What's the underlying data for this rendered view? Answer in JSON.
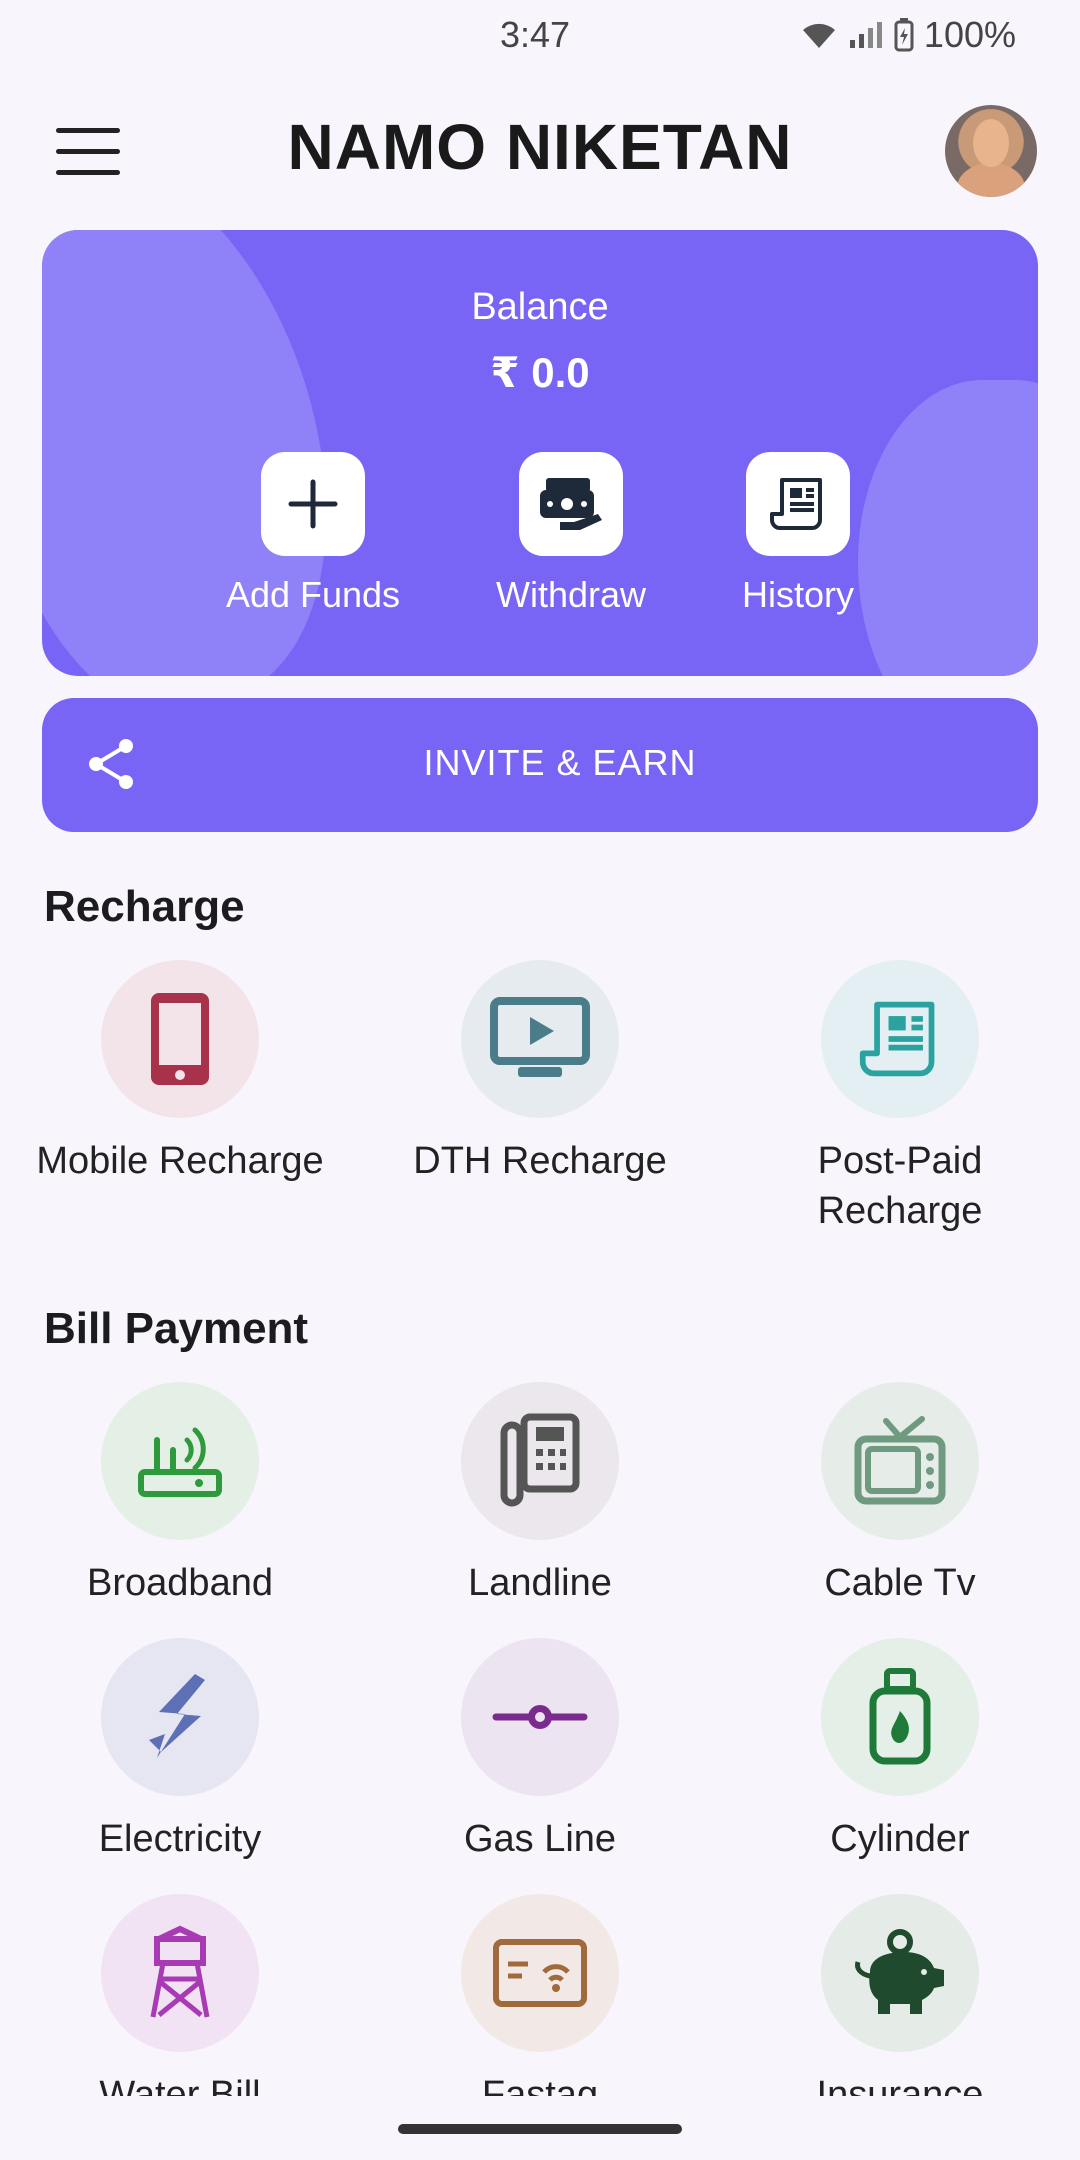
{
  "status": {
    "time": "3:47",
    "battery": "100%"
  },
  "app": {
    "title": "NAMO NIKETAN"
  },
  "balance": {
    "label": "Balance",
    "value": "₹ 0.0",
    "actions": [
      {
        "label": "Add Funds",
        "icon": "plus-icon"
      },
      {
        "label": "Withdraw",
        "icon": "cash-hand-icon"
      },
      {
        "label": "History",
        "icon": "receipt-icon"
      }
    ]
  },
  "invite": {
    "label": "INVITE & EARN",
    "icon": "share-icon"
  },
  "recharge": {
    "title": "Recharge",
    "items": [
      {
        "label": "Mobile Recharge",
        "icon": "mobile-phone-icon",
        "color": "#a8324a",
        "bg": "#f3e4ea"
      },
      {
        "label": "DTH Recharge",
        "icon": "tv-play-icon",
        "color": "#4a7c8a",
        "bg": "#e6ebf0"
      },
      {
        "label": "Post-Paid Recharge",
        "icon": "receipt-icon",
        "color": "#2aa3a0",
        "bg": "#e3eff2"
      }
    ]
  },
  "bills": {
    "title": "Bill Payment",
    "items": [
      {
        "label": "Broadband",
        "icon": "router-icon",
        "color": "#2f9a3c",
        "bg": "#e4efe6"
      },
      {
        "label": "Landline",
        "icon": "landline-phone-icon",
        "color": "#555",
        "bg": "#ebe7ec"
      },
      {
        "label": "Cable Tv",
        "icon": "tv-icon",
        "color": "#6f9a80",
        "bg": "#e6ede9"
      },
      {
        "label": "Electricity",
        "icon": "lightning-icon",
        "color": "#5d6fb5",
        "bg": "#e5e6f2"
      },
      {
        "label": "Gas Line",
        "icon": "gas-pipe-icon",
        "color": "#7b2a8e",
        "bg": "#ece4f0"
      },
      {
        "label": "Cylinder",
        "icon": "gas-cylinder-icon",
        "color": "#1f7a3a",
        "bg": "#e3efe7"
      },
      {
        "label": "Water Bill",
        "icon": "water-tower-icon",
        "color": "#a83bb4",
        "bg": "#f1e3f4"
      },
      {
        "label": "Fastag",
        "icon": "fastag-card-icon",
        "color": "#a06a3c",
        "bg": "#f2e9e6"
      },
      {
        "label": "Insurance",
        "icon": "piggy-bank-icon",
        "color": "#1f4a2e",
        "bg": "#e5ebe7"
      }
    ]
  }
}
